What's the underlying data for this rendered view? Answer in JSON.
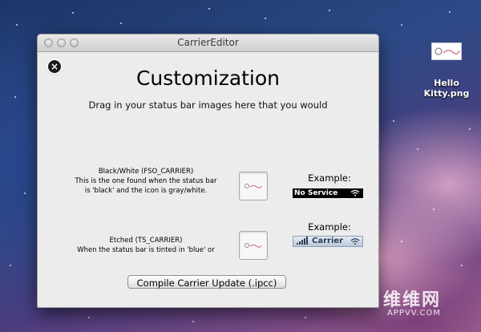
{
  "window": {
    "title": "CarrierEditor"
  },
  "main": {
    "heading": "Customization",
    "subheading": "Drag in your status bar images here that you would",
    "sections": [
      {
        "line1": "Black/White (FSO_CARRIER)",
        "line2": "This is the one found when the status bar",
        "line3": "is 'black' and the icon is gray/white.",
        "example_label": "Example:",
        "example_status": "No Service"
      },
      {
        "line1": "Etched (TS_CARRIER)",
        "line2": "When the status bar is tinted in 'blue' or",
        "example_label": "Example:",
        "example_status": "Carrier"
      }
    ],
    "compile_button": "Compile Carrier Update (.ipcc)"
  },
  "desktop": {
    "file_label_line1": "Hello",
    "file_label_line2": "Kitty.png"
  },
  "watermark": {
    "brand": "维维网",
    "url": "APPVV.COM"
  },
  "colors": {
    "window_bg": "#ececec",
    "status_black": "#000000",
    "status_blue": "#b9c7d8"
  }
}
